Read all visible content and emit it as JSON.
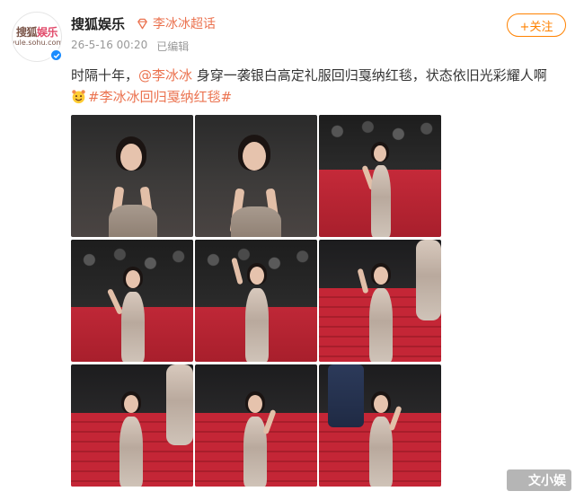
{
  "author": {
    "name": "搜狐娱乐",
    "avatar_text_main": "搜狐娱乐",
    "avatar_text_sub": "yule.sohu.com",
    "super_topic": "李冰冰超话"
  },
  "meta": {
    "date": "26-5-16 00:20",
    "edited": "已编辑"
  },
  "follow_label": "+关注",
  "post": {
    "prefix": "时隔十年，",
    "mention": "@李冰冰",
    "body": " 身穿一袭银白高定礼服回归戛纳红毯，状态依旧光彩耀人啊",
    "hashtag": "#李冰冰回归戛纳红毯#"
  },
  "photos": [
    {
      "scene": "closeup"
    },
    {
      "scene": "closeup"
    },
    {
      "scene": "press-wall"
    },
    {
      "scene": "press-wall"
    },
    {
      "scene": "press-wall"
    },
    {
      "scene": "stairs"
    },
    {
      "scene": "stairs"
    },
    {
      "scene": "stairs"
    },
    {
      "scene": "stairs"
    }
  ],
  "watermark": "文小娱",
  "colors": {
    "accent": "#eb7350",
    "follow": "#ff8200",
    "verified": "#1a8cff",
    "carpet": "#c42636"
  }
}
